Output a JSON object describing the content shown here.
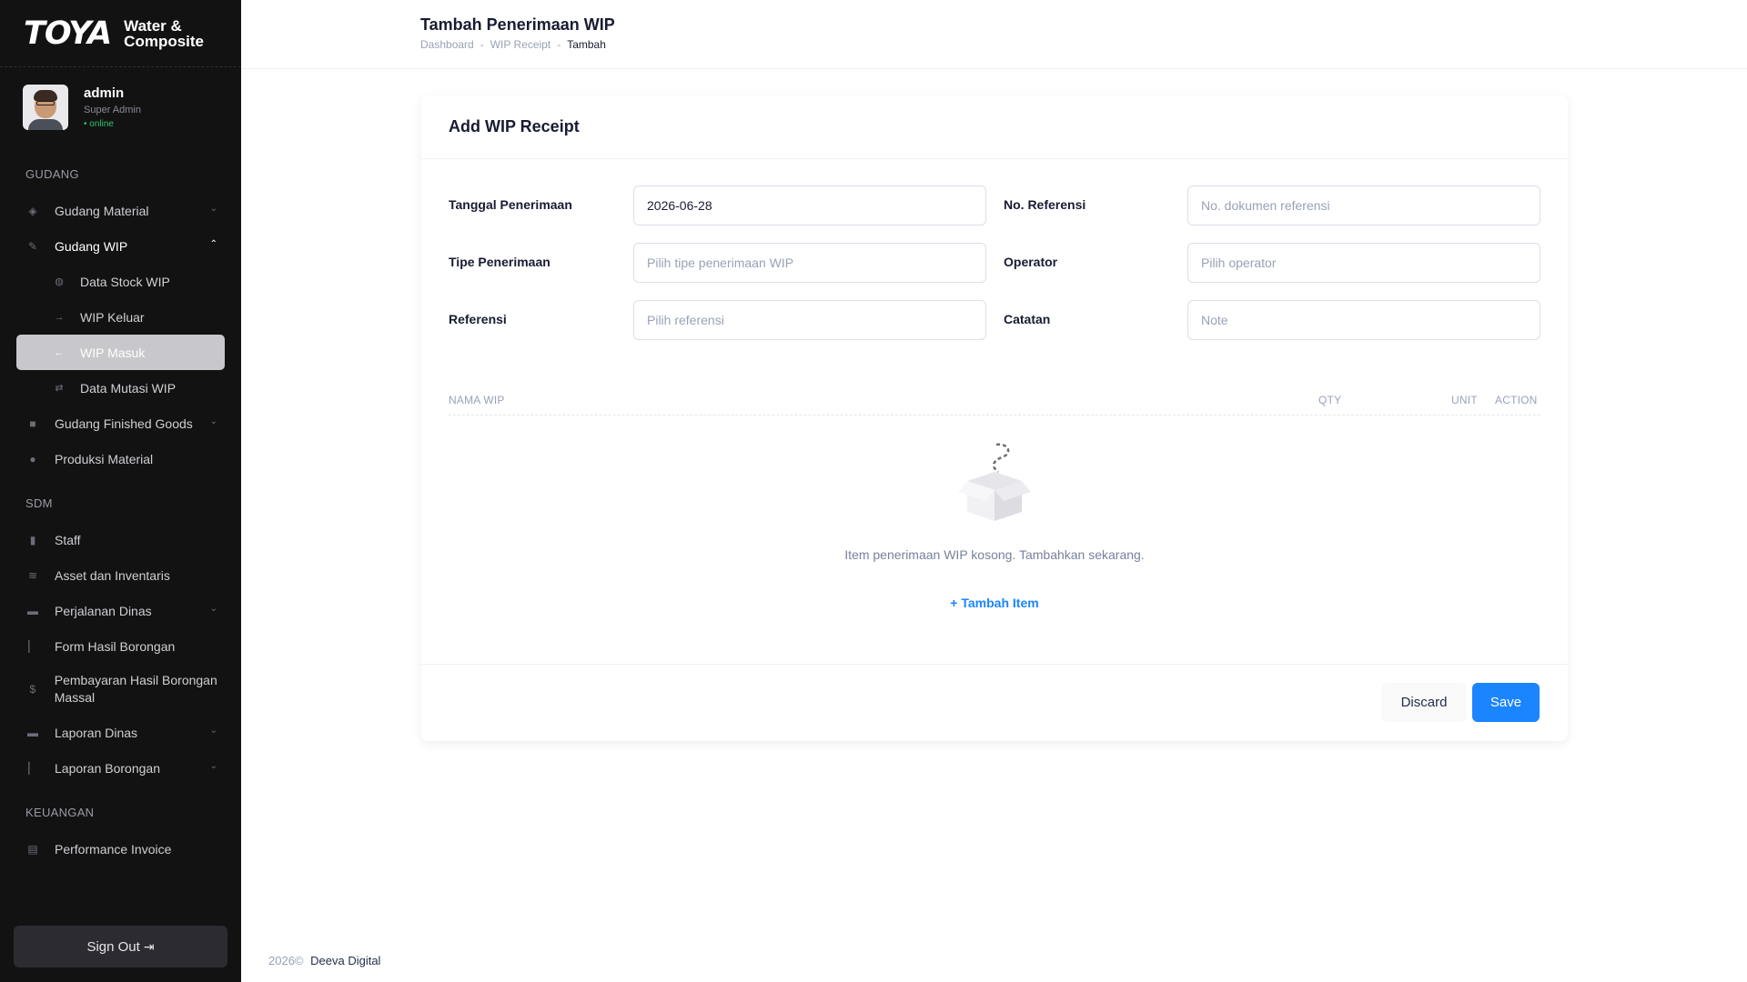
{
  "brand": {
    "logo": "TOYA",
    "sub_line1": "Water &",
    "sub_line2": "Composite"
  },
  "user": {
    "name": "admin",
    "role": "Super Admin",
    "status": "• online"
  },
  "sidebar": {
    "sections": {
      "gudang": "GUDANG",
      "sdm": "SDM",
      "keuangan": "KEUANGAN"
    },
    "gudang_items": [
      {
        "label": "Gudang Material",
        "icon": "warehouse-icon",
        "expandable": true
      },
      {
        "label": "Gudang WIP",
        "icon": "wrench-icon",
        "expandable": true,
        "open": true
      },
      {
        "label": "Gudang Finished Goods",
        "icon": "box-icon",
        "expandable": true
      },
      {
        "label": "Produksi Material",
        "icon": "circle-icon",
        "expandable": false
      }
    ],
    "wip_sub": [
      {
        "label": "Data Stock WIP",
        "icon": "stock-icon"
      },
      {
        "label": "WIP Keluar",
        "icon": "arrow-out-icon"
      },
      {
        "label": "WIP Masuk",
        "icon": "arrow-in-icon",
        "active": true
      },
      {
        "label": "Data Mutasi WIP",
        "icon": "swap-icon"
      }
    ],
    "sdm_items": [
      {
        "label": "Staff",
        "icon": "staff-icon"
      },
      {
        "label": "Asset dan Inventaris",
        "icon": "layers-icon"
      },
      {
        "label": "Perjalanan Dinas",
        "icon": "car-icon",
        "expandable": true
      },
      {
        "label": "Form Hasil Borongan",
        "icon": "chart-icon"
      },
      {
        "label": "Pembayaran Hasil Borongan Massal",
        "icon": "dollar-icon"
      },
      {
        "label": "Laporan Dinas",
        "icon": "car-icon",
        "expandable": true
      },
      {
        "label": "Laporan Borongan",
        "icon": "chart-icon",
        "expandable": true
      }
    ],
    "keuangan_items": [
      {
        "label": "Performance Invoice",
        "icon": "invoice-icon"
      }
    ],
    "signout": "Sign Out"
  },
  "header": {
    "title": "Tambah Penerimaan WIP",
    "breadcrumb": [
      "Dashboard",
      "WIP Receipt",
      "Tambah"
    ]
  },
  "card": {
    "title": "Add WIP Receipt",
    "fields": {
      "tanggal_label": "Tanggal Penerimaan",
      "tanggal_value": "2026-06-28",
      "noref_label": "No. Referensi",
      "noref_placeholder": "No. dokumen referensi",
      "tipe_label": "Tipe Penerimaan",
      "tipe_placeholder": "Pilih tipe penerimaan WIP",
      "operator_label": "Operator",
      "operator_placeholder": "Pilih operator",
      "referensi_label": "Referensi",
      "referensi_placeholder": "Pilih referensi",
      "catatan_label": "Catatan",
      "catatan_placeholder": "Note"
    },
    "table": {
      "columns": [
        "NAMA WIP",
        "QTY",
        "UNIT",
        "ACTION"
      ],
      "empty_text": "Item penerimaan WIP kosong. Tambahkan sekarang.",
      "add_item": "+ Tambah Item"
    },
    "buttons": {
      "discard": "Discard",
      "save": "Save"
    }
  },
  "footer": {
    "year": "2026©",
    "company": "Deeva Digital"
  }
}
